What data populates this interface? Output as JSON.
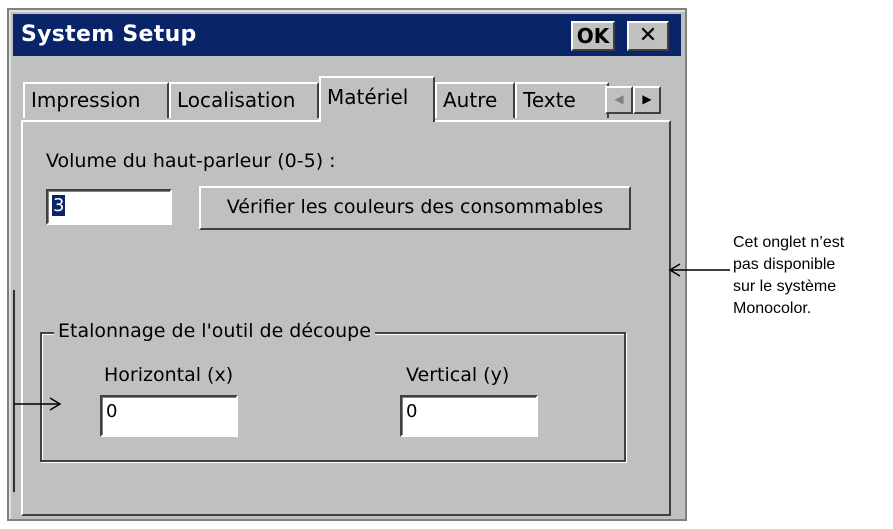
{
  "window": {
    "title": "System Setup",
    "ok_label": "OK",
    "close_label": "✕"
  },
  "tabs": [
    {
      "label": "Impression"
    },
    {
      "label": "Localisation"
    },
    {
      "label": "Matériel",
      "active": true
    },
    {
      "label": "Autre"
    },
    {
      "label": "Texte"
    }
  ],
  "scroll": {
    "left_icon": "◀",
    "right_icon": "▶"
  },
  "speaker": {
    "label": "Volume du haut-parleur (0-5) :",
    "value": "3"
  },
  "check_colors_button": "Vérifier les couleurs des consommables",
  "calibration": {
    "legend": "Etalonnage de l'outil de découpe",
    "horizontal_label": "Horizontal (x)",
    "horizontal_value": "0",
    "vertical_label": "Vertical (y)",
    "vertical_value": "0"
  },
  "annotation": {
    "lines": [
      "Cet onglet n’est",
      "pas disponible",
      "sur le système",
      "Monocolor."
    ]
  }
}
